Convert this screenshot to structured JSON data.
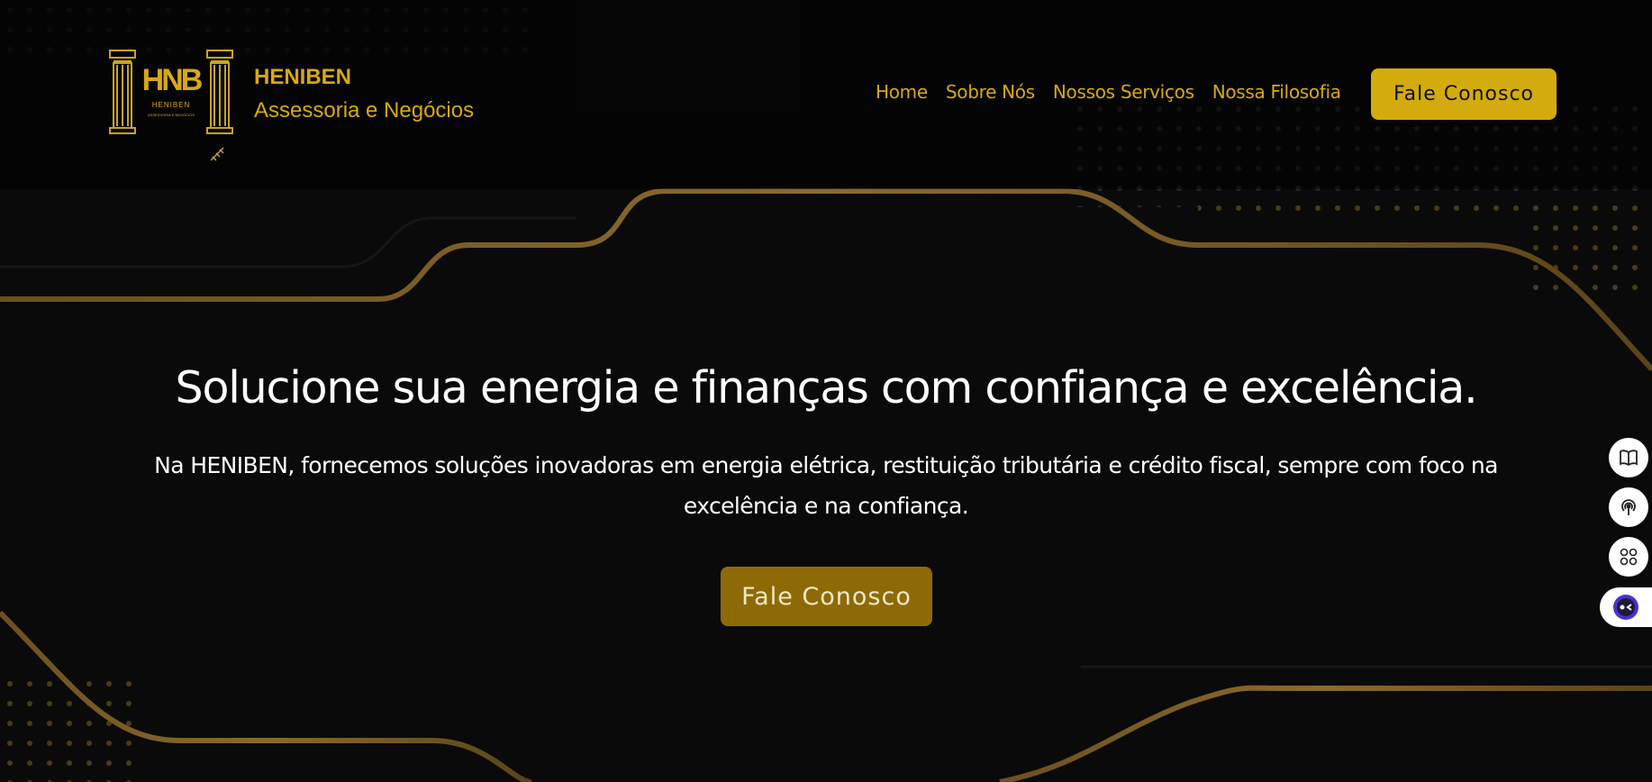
{
  "brand": {
    "logo_text": "HNB",
    "logo_caption": "HENIBEN",
    "logo_tagline": "ASSESSORIA E NEGÓCIOS",
    "name": "HENIBEN",
    "subtitle": "Assessoria e Negócios"
  },
  "nav": {
    "items": [
      {
        "label": "Home"
      },
      {
        "label": "Sobre Nós"
      },
      {
        "label": "Nossos Serviços"
      },
      {
        "label": "Nossa Filosofia"
      }
    ],
    "cta_label": "Fale Conosco"
  },
  "hero": {
    "title": "Solucione sua energia e finanças com confiança e excelência.",
    "text": "Na HENIBEN, fornecemos soluções inovadoras em energia elétrica, restituição tributária e crédito fiscal, sempre com foco na excelência e na confiança.",
    "cta_label": "Fale Conosco"
  },
  "side_tools": [
    {
      "icon": "book-icon"
    },
    {
      "icon": "broadcast-icon"
    },
    {
      "icon": "apps-icon"
    },
    {
      "icon": "assistant-face-icon"
    }
  ],
  "colors": {
    "background": "#0a0a0a",
    "accent_gold": "#d4ab0c",
    "hero_button": "#8e6a06",
    "text": "#ffffff"
  }
}
